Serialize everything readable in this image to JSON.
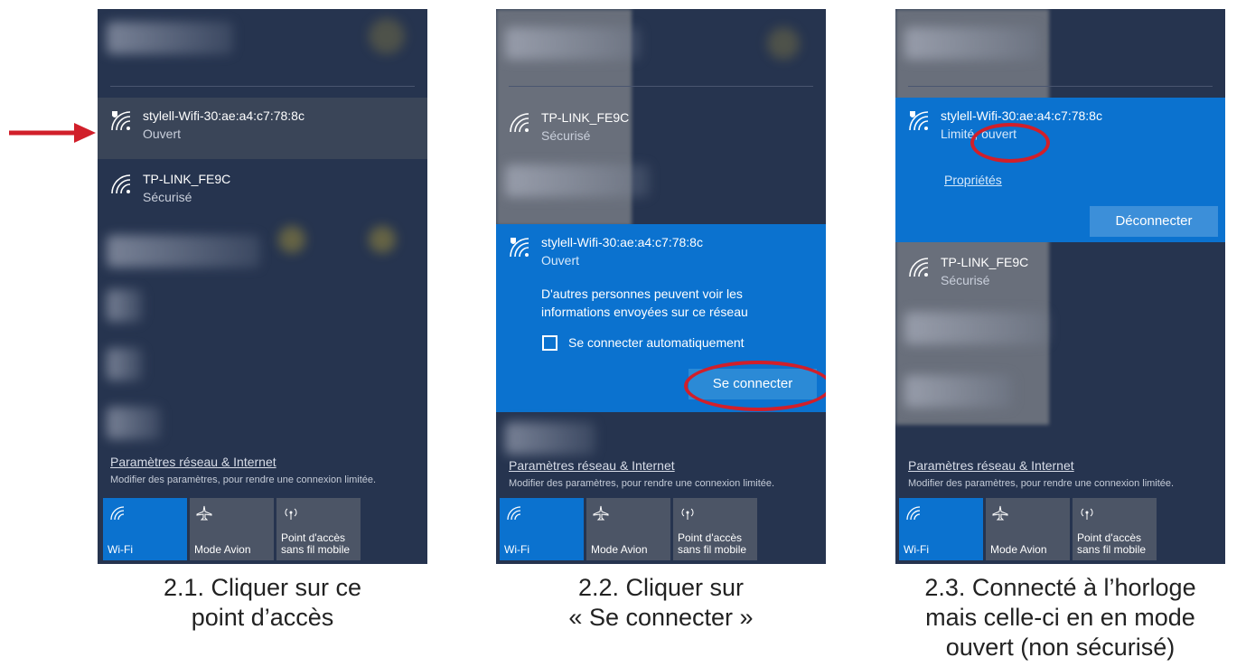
{
  "panel1": {
    "nets": [
      {
        "name": "stylell-Wifi-30:ae:a4:c7:78:8c",
        "status": "Ouvert"
      },
      {
        "name": "TP-LINK_FE9C",
        "status": "Sécurisé"
      }
    ]
  },
  "panel2": {
    "top_net": {
      "name": "TP-LINK_FE9C",
      "status": "Sécurisé"
    },
    "selected": {
      "name": "stylell-Wifi-30:ae:a4:c7:78:8c",
      "status": "Ouvert",
      "warning_line1": "D'autres personnes peuvent voir les",
      "warning_line2": "informations envoyées sur ce réseau",
      "auto_connect_label": "Se connecter automatiquement",
      "connect_button": "Se connecter"
    }
  },
  "panel3": {
    "selected": {
      "name": "stylell-Wifi-30:ae:a4:c7:78:8c",
      "status": "Limité, ouvert",
      "properties_link": "Propriétés",
      "disconnect_button": "Déconnecter"
    },
    "other_net": {
      "name": "TP-LINK_FE9C",
      "status": "Sécurisé"
    }
  },
  "footer": {
    "link": "Paramètres réseau & Internet",
    "sub": "Modifier des paramètres, pour rendre une connexion limitée."
  },
  "tiles": [
    {
      "line1": "",
      "line2": "Wi-Fi",
      "icon": "wifi-icon",
      "active": true
    },
    {
      "line1": "",
      "line2": "Mode Avion",
      "icon": "airplane-icon",
      "active": false
    },
    {
      "line1": "Point d'accès",
      "line2": "sans fil mobile",
      "icon": "hotspot-icon",
      "active": false
    }
  ],
  "captions": {
    "c1": [
      "2.1. Cliquer sur ce",
      "point d’accès"
    ],
    "c2": [
      "2.2. Cliquer sur",
      "« Se connecter »"
    ],
    "c3": [
      "2.3. Connecté à l’horloge",
      "mais celle-ci en en mode",
      "ouvert (non sécurisé)"
    ]
  },
  "colors": {
    "accent": "#0b72cf",
    "highlight_ring": "#d11f2a",
    "arrow": "#d11f2a",
    "panel_bg": "#26344f"
  }
}
